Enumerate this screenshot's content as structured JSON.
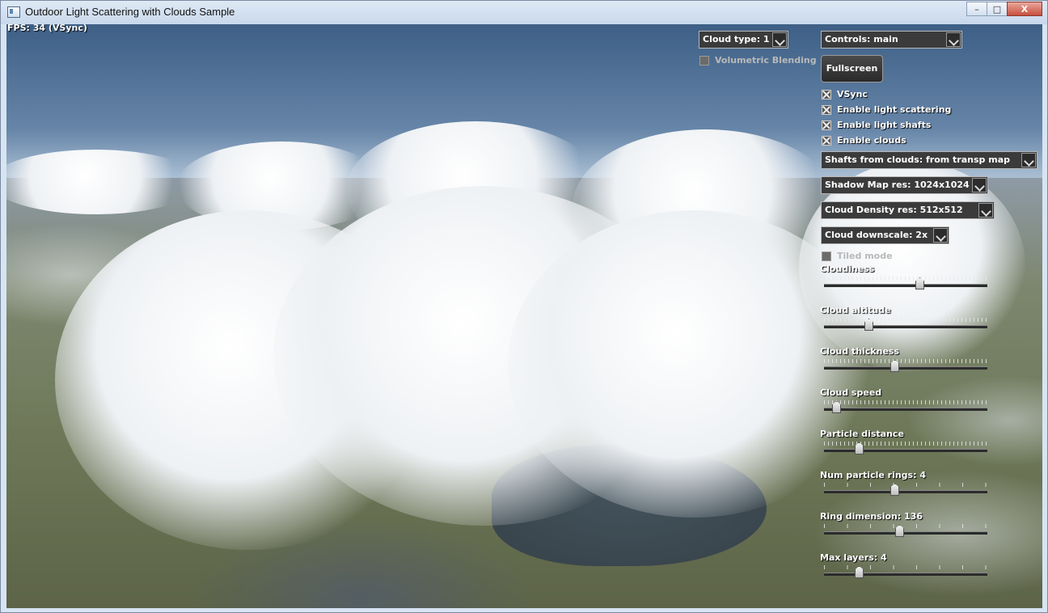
{
  "window": {
    "title": "Outdoor Light Scattering with Clouds Sample"
  },
  "caption_buttons": {
    "minimize": "–",
    "maximize": "□",
    "close": "X"
  },
  "fps": "FPS: 34 (VSync)",
  "cloud_type_combo": "Cloud type: 1",
  "volumetric_blending": {
    "label": "Volumetric Blending",
    "checked": false,
    "enabled": false
  },
  "controls_combo": "Controls: main",
  "fullscreen_button": "Fullscreen",
  "checkboxes": [
    {
      "label": "VSync",
      "checked": true
    },
    {
      "label": "Enable light scattering",
      "checked": true
    },
    {
      "label": "Enable light shafts",
      "checked": true
    },
    {
      "label": "Enable clouds",
      "checked": true
    }
  ],
  "combos": [
    "Shafts from clouds: from transp map",
    "Shadow Map res: 1024x1024",
    "Cloud Density res: 512x512",
    "Cloud downscale: 2x"
  ],
  "tiled_mode": {
    "label": "Tiled mode",
    "checked": false,
    "enabled": false
  },
  "sliders": [
    {
      "label": "Cloudiness",
      "value": 0.59
    },
    {
      "label": "Cloud altitude",
      "value": 0.26
    },
    {
      "label": "Cloud thickness",
      "value": 0.43
    },
    {
      "label": "Cloud speed",
      "value": 0.05
    },
    {
      "label": "Particle distance",
      "value": 0.2
    },
    {
      "label": "Num particle rings: 4",
      "value": 0.43
    },
    {
      "label": "Ring dimension: 136",
      "value": 0.46
    },
    {
      "label": "Max layers: 4",
      "value": 0.2
    }
  ]
}
